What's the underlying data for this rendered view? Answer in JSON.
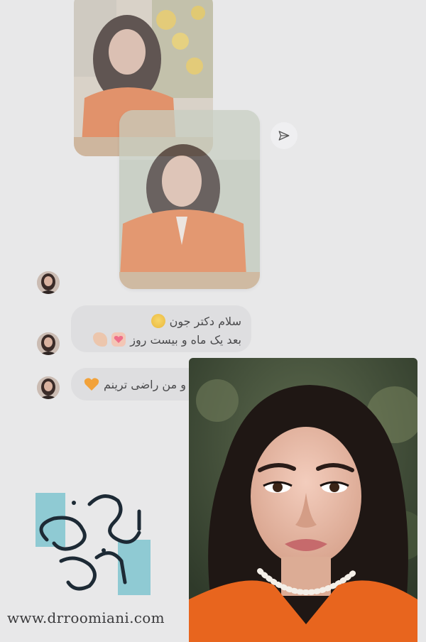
{
  "chat": {
    "messages": [
      {
        "line1": "سلام دکتر جون",
        "line2": "بعد یک ماه و بیست روز"
      },
      {
        "line1": "و من راضی ترینم"
      }
    ]
  },
  "icons": {
    "share": "paper-plane-icon",
    "emoji_pleading": "pleading-face-emoji",
    "emoji_heart_hands": "heart-hands-emoji",
    "emoji_muscle": "flexed-biceps-emoji",
    "emoji_heart": "orange-heart-emoji"
  },
  "branding": {
    "website": "www.drroomiani.com"
  },
  "colors": {
    "background": "#e8e8e9",
    "bubble": "#dedee0",
    "logo_teal": "#7fc4cf",
    "logo_ink": "#1d2a35",
    "shirt_orange": "#e8651e"
  }
}
